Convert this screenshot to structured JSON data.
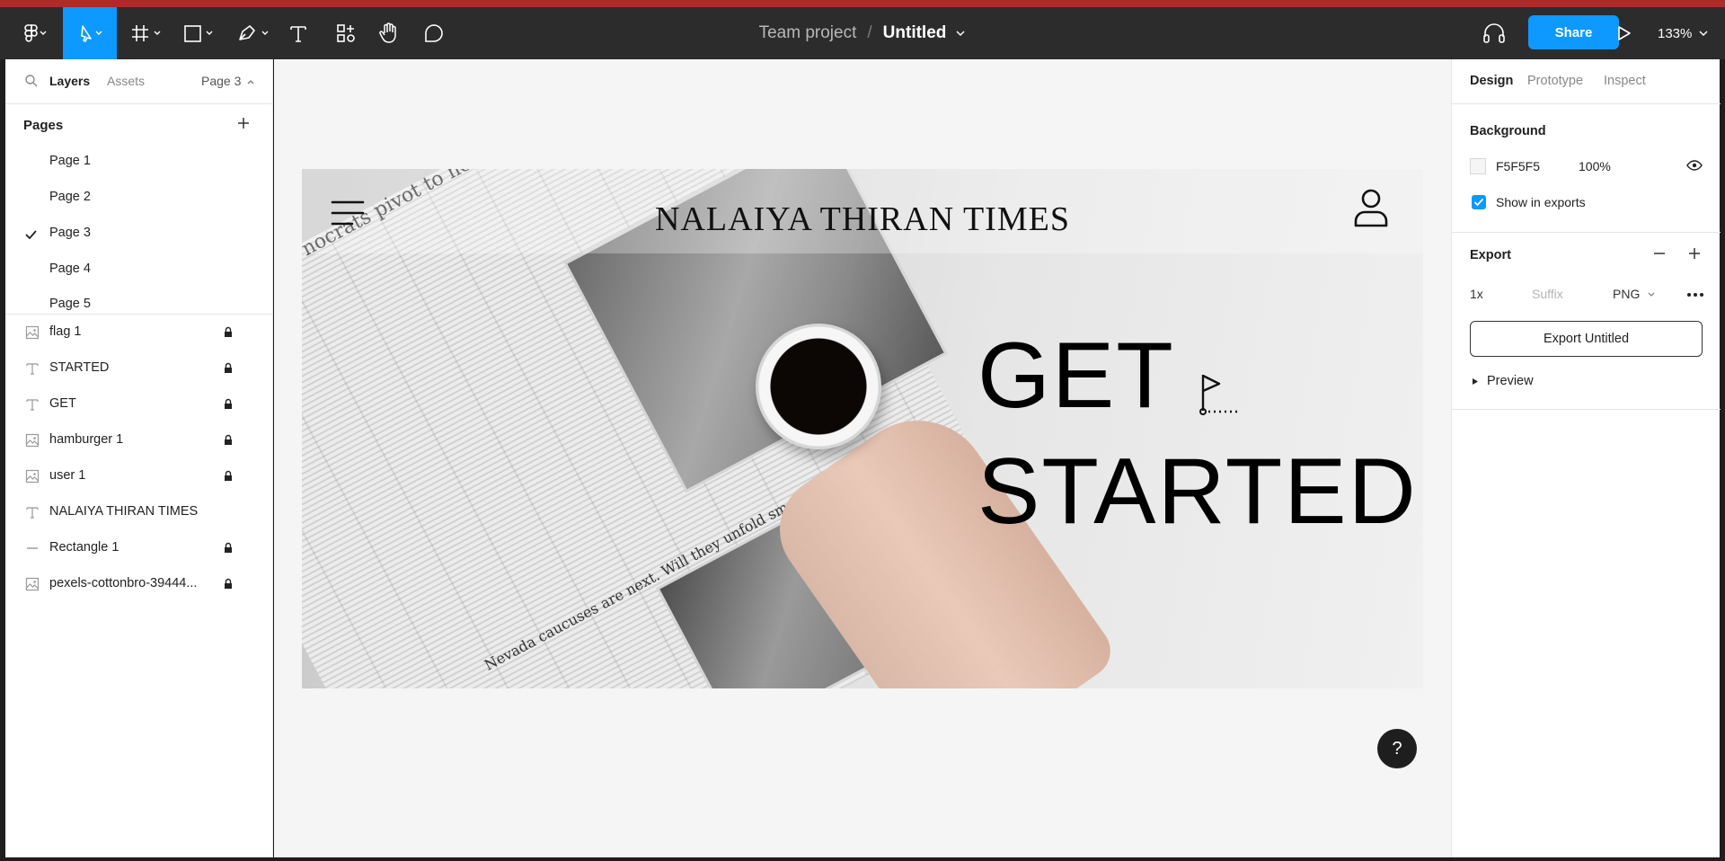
{
  "toolbar": {
    "team": "Team project",
    "separator": "/",
    "file": "Untitled",
    "share_label": "Share",
    "zoom": "133%"
  },
  "left_panel": {
    "tabs": [
      "Layers",
      "Assets"
    ],
    "page_selector": "Page 3",
    "pages_heading": "Pages",
    "pages": [
      "Page 1",
      "Page 2",
      "Page 3",
      "Page 4",
      "Page 5"
    ],
    "current_page": "Page 3",
    "layers": [
      {
        "name": "flag 1",
        "type": "image",
        "locked": true
      },
      {
        "name": "STARTED",
        "type": "text",
        "locked": true
      },
      {
        "name": "GET",
        "type": "text",
        "locked": true
      },
      {
        "name": "hamburger 1",
        "type": "image",
        "locked": true
      },
      {
        "name": "user 1",
        "type": "image",
        "locked": true
      },
      {
        "name": "NALAIYA THIRAN TIMES",
        "type": "text",
        "locked": false
      },
      {
        "name": "Rectangle 1",
        "type": "line",
        "locked": true
      },
      {
        "name": "pexels-cottonbro-39444...",
        "type": "image",
        "locked": true
      }
    ]
  },
  "canvas": {
    "brand": "NALAIYA THIRAN TIMES",
    "headline_1": "GET",
    "headline_2": "STARTED",
    "newspaper_text_1": "nocrats pivot to health care and",
    "newspaper_text_2": "Nevada caucuses are next. Will they unfold smoothly?",
    "background_color": "#F5F5F5"
  },
  "right_panel": {
    "tabs": [
      "Design",
      "Prototype",
      "Inspect"
    ],
    "background_title": "Background",
    "bg_hex": "F5F5F5",
    "bg_opacity": "100%",
    "show_in_exports": "Show in exports",
    "export_title": "Export",
    "scale": "1x",
    "suffix_placeholder": "Suffix",
    "format": "PNG",
    "export_button": "Export Untitled",
    "preview": "Preview"
  },
  "help_label": "?",
  "colors": {
    "accent": "#0d99ff",
    "toolbar": "#2c2c2c",
    "stripe": "#b02a2a"
  }
}
